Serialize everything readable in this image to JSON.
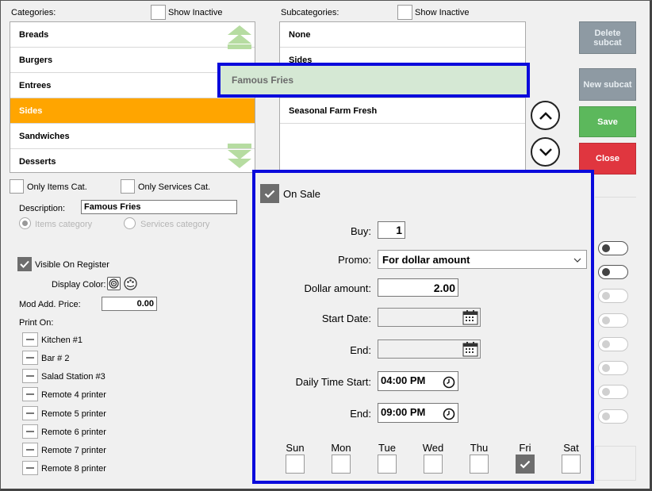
{
  "categories": {
    "header": "Categories:",
    "show_inactive": "Show Inactive",
    "items": [
      {
        "label": "Breads"
      },
      {
        "label": "Burgers"
      },
      {
        "label": "Entrees"
      },
      {
        "label": "Sides",
        "selected": true
      },
      {
        "label": "Sandwiches"
      },
      {
        "label": "Desserts"
      }
    ],
    "only_items": "Only Items Cat.",
    "only_services": "Only Services Cat."
  },
  "subcategories": {
    "header": "Subcategories:",
    "show_inactive": "Show Inactive",
    "items": [
      {
        "label": "None"
      },
      {
        "label": "Sides"
      },
      {
        "label": "Famous Fries",
        "highlighted": true
      },
      {
        "label": "Seasonal Farm Fresh"
      }
    ]
  },
  "buttons": {
    "delete_subcat": "Delete subcat",
    "new_subcat": "New subcat",
    "save": "Save",
    "close": "Close"
  },
  "details": {
    "description_label": "Description:",
    "description_value": "Famous Fries",
    "radio_items": "Items category",
    "radio_services": "Services category",
    "visible_on_register": "Visible On Register",
    "display_color": "Display Color:",
    "mod_add_price_label": "Mod Add. Price:",
    "mod_add_price_value": "0.00",
    "print_on": "Print On:",
    "printers": [
      "Kitchen #1",
      "Bar # 2",
      "Salad Station #3",
      "Remote 4 printer",
      "Remote 5 printer",
      "Remote 6 printer",
      "Remote 7 printer",
      "Remote 8 printer"
    ]
  },
  "sale": {
    "on_sale": "On Sale",
    "on_sale_checked": true,
    "buy_label": "Buy:",
    "buy_value": "1",
    "promo_label": "Promo:",
    "promo_value": "For dollar amount",
    "dollar_label": "Dollar amount:",
    "dollar_value": "2.00",
    "start_date_label": "Start Date:",
    "start_date_value": "",
    "end_date_label": "End:",
    "end_date_value": "",
    "time_start_label": "Daily Time Start:",
    "time_start_value": "04:00 PM",
    "time_end_label": "End:",
    "time_end_value": "09:00 PM",
    "days": [
      {
        "label": "Sun",
        "checked": false
      },
      {
        "label": "Mon",
        "checked": false
      },
      {
        "label": "Tue",
        "checked": false
      },
      {
        "label": "Wed",
        "checked": false
      },
      {
        "label": "Thu",
        "checked": false
      },
      {
        "label": "Fri",
        "checked": true
      },
      {
        "label": "Sat",
        "checked": false
      }
    ]
  },
  "colors": {
    "selected_row": "#ffa500",
    "highlight_border": "#0a0adc",
    "highlight_fill": "#d5e8d4",
    "save": "#5cb85c",
    "close": "#e0363f"
  }
}
